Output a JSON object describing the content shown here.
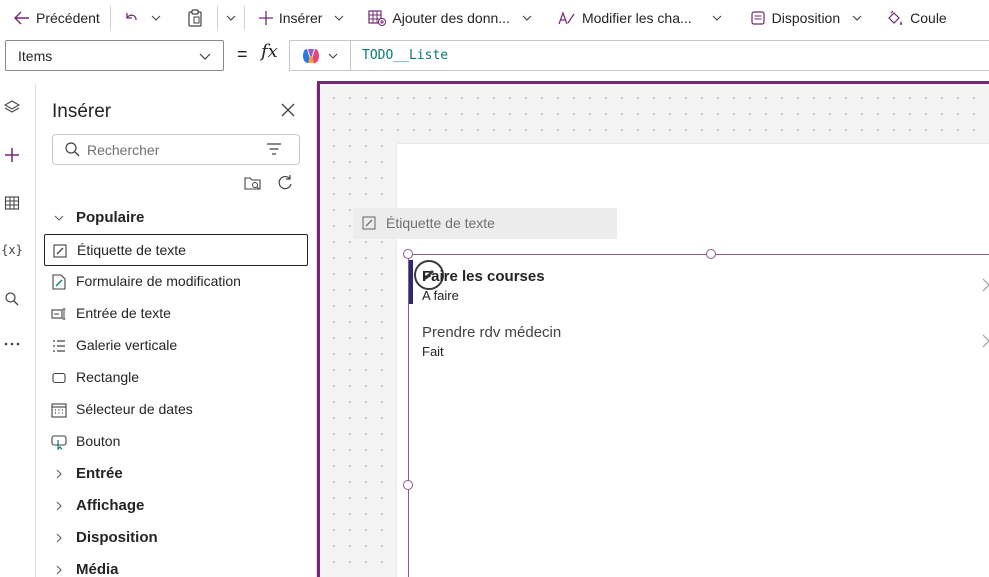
{
  "toolbar": {
    "back_label": "Précédent",
    "insert_label": "Insérer",
    "add_data_label": "Ajouter des donn...",
    "modify_fields_label": "Modifier les cha...",
    "layout_label": "Disposition",
    "color_label": "Coule"
  },
  "formula": {
    "property": "Items",
    "equals": "=",
    "fx": "fx",
    "value": "TODO__Liste"
  },
  "insert_panel": {
    "title": "Insérer",
    "search_placeholder": "Rechercher",
    "sections": {
      "popular": "Populaire",
      "input": "Entrée",
      "display": "Affichage",
      "layout": "Disposition",
      "media": "Média"
    },
    "items": [
      {
        "label": "Étiquette de texte",
        "icon": "text-label-icon"
      },
      {
        "label": "Formulaire de modification",
        "icon": "edit-form-icon"
      },
      {
        "label": "Entrée de texte",
        "icon": "text-input-icon"
      },
      {
        "label": "Galerie verticale",
        "icon": "vertical-gallery-icon"
      },
      {
        "label": "Rectangle",
        "icon": "rectangle-icon"
      },
      {
        "label": "Sélecteur de dates",
        "icon": "date-picker-icon"
      },
      {
        "label": "Bouton",
        "icon": "button-icon"
      }
    ]
  },
  "canvas": {
    "drag_ghost_label": "Étiquette de texte",
    "gallery": [
      {
        "title": "Faire les courses",
        "subtitle": "A faire"
      },
      {
        "title": "Prendre rdv médecin",
        "subtitle": "Fait"
      }
    ]
  },
  "colors": {
    "selection_border": "#742774",
    "formula_text": "#0b7a75",
    "accent_plus": "#742774"
  }
}
